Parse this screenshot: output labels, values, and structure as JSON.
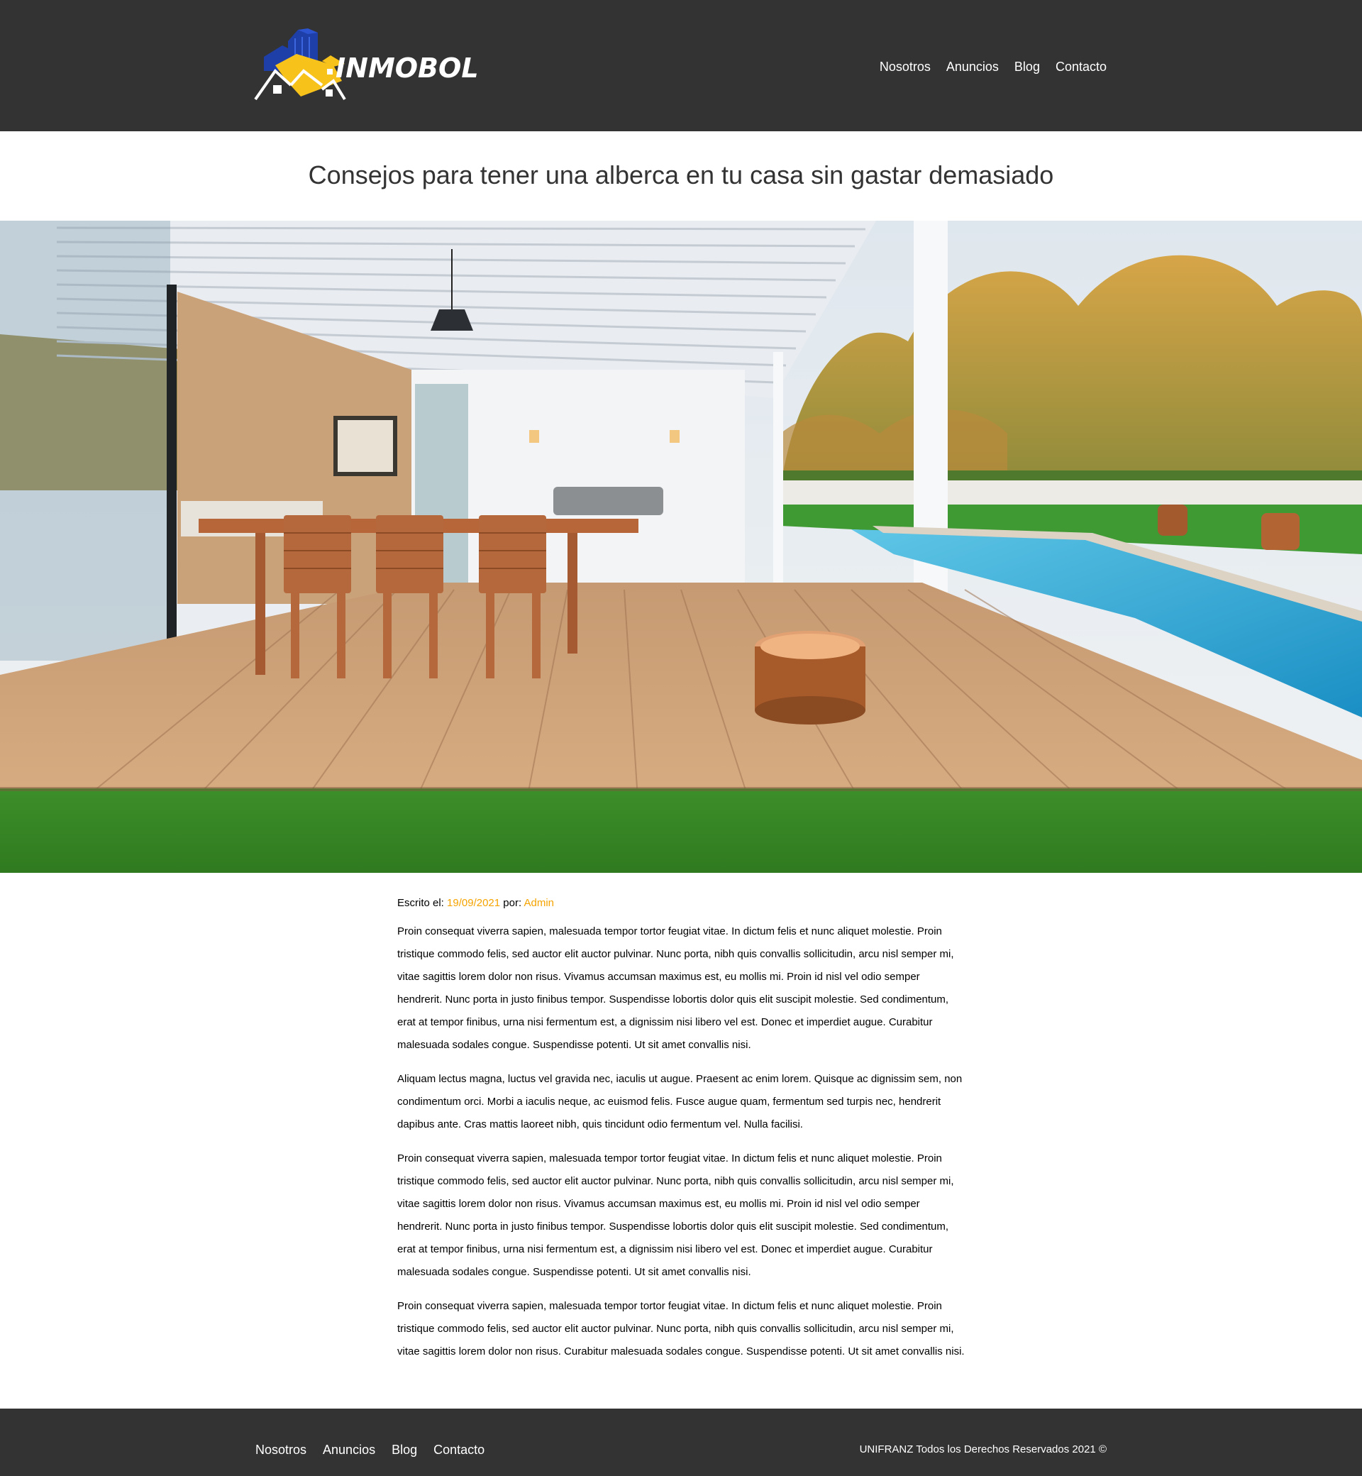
{
  "header": {
    "logo_text": "INMOBOL",
    "nav": [
      "Nosotros",
      "Anuncios",
      "Blog",
      "Contacto"
    ]
  },
  "article": {
    "title": "Consejos para tener una alberca en tu casa sin gastar demasiado",
    "meta_prefix": "Escrito el:",
    "date": "19/09/2021",
    "by_label": "por:",
    "author": "Admin",
    "paragraphs": [
      "Proin consequat viverra sapien, malesuada tempor tortor feugiat vitae. In dictum felis et nunc aliquet molestie. Proin tristique commodo felis, sed auctor elit auctor pulvinar. Nunc porta, nibh quis convallis sollicitudin, arcu nisl semper mi, vitae sagittis lorem dolor non risus. Vivamus accumsan maximus est, eu mollis mi. Proin id nisl vel odio semper hendrerit. Nunc porta in justo finibus tempor. Suspendisse lobortis dolor quis elit suscipit molestie. Sed condimentum, erat at tempor finibus, urna nisi fermentum est, a dignissim nisi libero vel est. Donec et imperdiet augue. Curabitur malesuada sodales congue. Suspendisse potenti. Ut sit amet convallis nisi.",
      "Aliquam lectus magna, luctus vel gravida nec, iaculis ut augue. Praesent ac enim lorem. Quisque ac dignissim sem, non condimentum orci. Morbi a iaculis neque, ac euismod felis. Fusce augue quam, fermentum sed turpis nec, hendrerit dapibus ante. Cras mattis laoreet nibh, quis tincidunt odio fermentum vel. Nulla facilisi.",
      "Proin consequat viverra sapien, malesuada tempor tortor feugiat vitae. In dictum felis et nunc aliquet molestie. Proin tristique commodo felis, sed auctor elit auctor pulvinar. Nunc porta, nibh quis convallis sollicitudin, arcu nisl semper mi, vitae sagittis lorem dolor non risus. Vivamus accumsan maximus est, eu mollis mi. Proin id nisl vel odio semper hendrerit. Nunc porta in justo finibus tempor. Suspendisse lobortis dolor quis elit suscipit molestie. Sed condimentum, erat at tempor finibus, urna nisi fermentum est, a dignissim nisi libero vel est. Donec et imperdiet augue. Curabitur malesuada sodales congue. Suspendisse potenti. Ut sit amet convallis nisi.",
      "Proin consequat viverra sapien, malesuada tempor tortor feugiat vitae. In dictum felis et nunc aliquet molestie. Proin tristique commodo felis, sed auctor elit auctor pulvinar. Nunc porta, nibh quis convallis sollicitudin, arcu nisl semper mi, vitae sagittis lorem dolor non risus. Curabitur malesuada sodales congue. Suspendisse potenti. Ut sit amet convallis nisi."
    ]
  },
  "footer": {
    "nav": [
      "Nosotros",
      "Anuncios",
      "Blog",
      "Contacto"
    ],
    "copyright": "UNIFRANZ Todos los Derechos Reservados 2021 ©"
  },
  "colors": {
    "header_bg": "#333333",
    "accent": "#f5a300",
    "logo_blue": "#1f3fa8",
    "logo_yellow": "#f7c21a"
  }
}
